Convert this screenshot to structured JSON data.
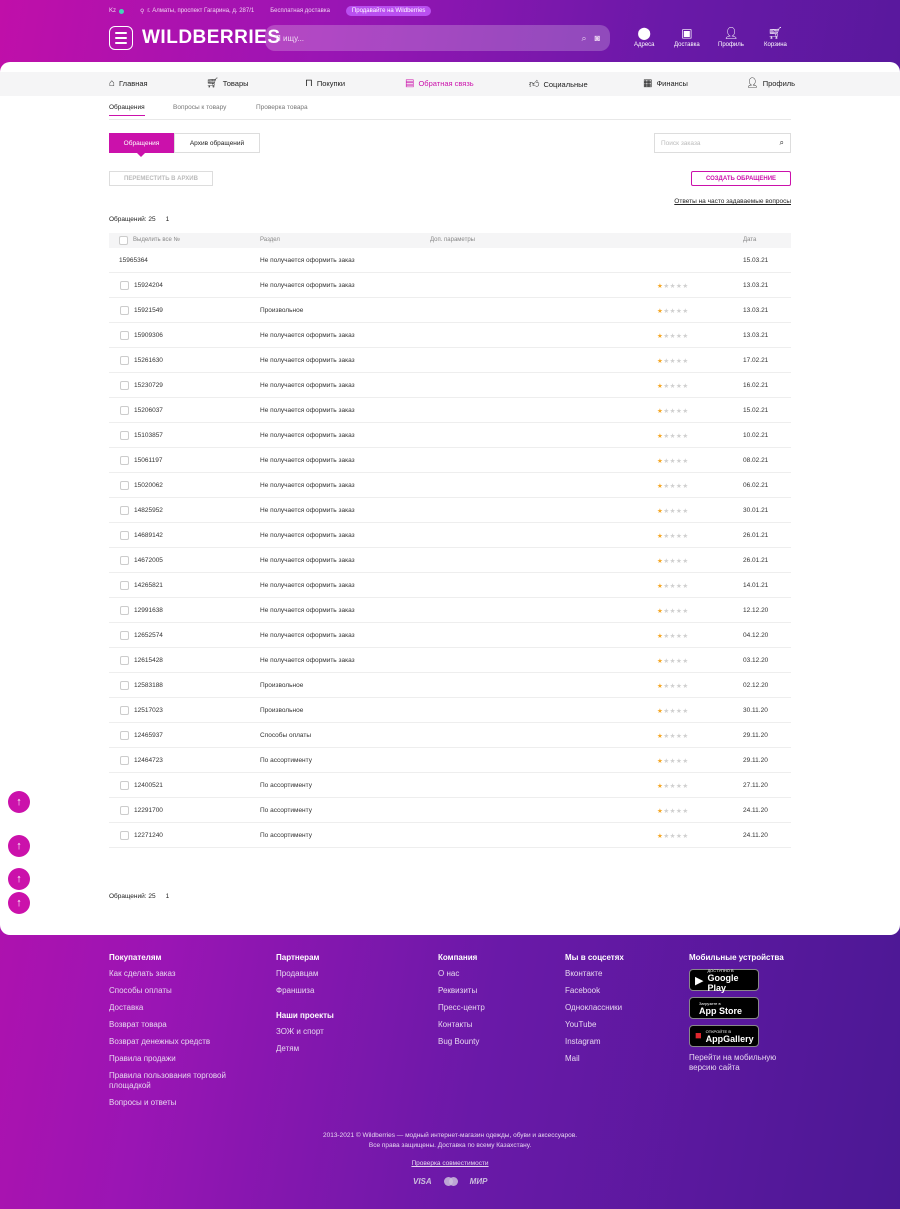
{
  "header": {
    "region": "Kz",
    "address": "г. Алматы, проспект Гагарина, д. 287/1",
    "free_delivery": "Бесплатная доставка",
    "sell_button": "Продавайте на Wildberries",
    "logo": "WILDBERRIES",
    "search_placeholder": "Я ищу...",
    "nav": {
      "addresses": "Адреса",
      "delivery": "Доставка",
      "profile": "Профиль",
      "cart": "Корзина"
    }
  },
  "category_nav": {
    "items": [
      "Главная",
      "Товары",
      "Покупки",
      "Обратная связь",
      "Социальные",
      "Финансы",
      "Профиль"
    ],
    "active_index": 3
  },
  "subtabs": [
    "Обращения",
    "Вопросы к товару",
    "Проверка товара"
  ],
  "toggle": {
    "active": "Обращения",
    "archive": "Архив обращений"
  },
  "order_search_placeholder": "Поиск заказа",
  "buttons": {
    "move_to_archive": "ПЕРЕМЕСТИТЬ В АРХИВ",
    "create_request": "СОЗДАТЬ ОБРАЩЕНИЕ"
  },
  "faq_link": "Ответы на часто задаваемые вопросы",
  "count": {
    "label": "Обращений: 25",
    "page": "1"
  },
  "table": {
    "headers": {
      "select_all": "Выделить все №",
      "section": "Раздел",
      "params": "Доп. параметры",
      "date": "Дата"
    },
    "rows": [
      {
        "id": "15965364",
        "section": "Не получается оформить заказ",
        "date": "15.03.21",
        "rating": 0,
        "checkbox": false
      },
      {
        "id": "15924204",
        "section": "Не получается оформить заказ",
        "date": "13.03.21",
        "rating": 1,
        "checkbox": true
      },
      {
        "id": "15921549",
        "section": "Произвольное",
        "date": "13.03.21",
        "rating": 1,
        "checkbox": true
      },
      {
        "id": "15909306",
        "section": "Не получается оформить заказ",
        "date": "13.03.21",
        "rating": 1,
        "checkbox": true
      },
      {
        "id": "15261630",
        "section": "Не получается оформить заказ",
        "date": "17.02.21",
        "rating": 1,
        "checkbox": true
      },
      {
        "id": "15230729",
        "section": "Не получается оформить заказ",
        "date": "16.02.21",
        "rating": 1,
        "checkbox": true
      },
      {
        "id": "15206037",
        "section": "Не получается оформить заказ",
        "date": "15.02.21",
        "rating": 1,
        "checkbox": true
      },
      {
        "id": "15103857",
        "section": "Не получается оформить заказ",
        "date": "10.02.21",
        "rating": 1,
        "checkbox": true
      },
      {
        "id": "15061197",
        "section": "Не получается оформить заказ",
        "date": "08.02.21",
        "rating": 1,
        "checkbox": true
      },
      {
        "id": "15020062",
        "section": "Не получается оформить заказ",
        "date": "06.02.21",
        "rating": 1,
        "checkbox": true
      },
      {
        "id": "14825952",
        "section": "Не получается оформить заказ",
        "date": "30.01.21",
        "rating": 1,
        "checkbox": true
      },
      {
        "id": "14689142",
        "section": "Не получается оформить заказ",
        "date": "26.01.21",
        "rating": 1,
        "checkbox": true
      },
      {
        "id": "14672005",
        "section": "Не получается оформить заказ",
        "date": "26.01.21",
        "rating": 1,
        "checkbox": true
      },
      {
        "id": "14265821",
        "section": "Не получается оформить заказ",
        "date": "14.01.21",
        "rating": 1,
        "checkbox": true
      },
      {
        "id": "12991638",
        "section": "Не получается оформить заказ",
        "date": "12.12.20",
        "rating": 1,
        "checkbox": true
      },
      {
        "id": "12652574",
        "section": "Не получается оформить заказ",
        "date": "04.12.20",
        "rating": 1,
        "checkbox": true
      },
      {
        "id": "12615428",
        "section": "Не получается оформить заказ",
        "date": "03.12.20",
        "rating": 1,
        "checkbox": true
      },
      {
        "id": "12583188",
        "section": "Произвольное",
        "date": "02.12.20",
        "rating": 1,
        "checkbox": true
      },
      {
        "id": "12517023",
        "section": "Произвольное",
        "date": "30.11.20",
        "rating": 1,
        "checkbox": true
      },
      {
        "id": "12465937",
        "section": "Способы оплаты",
        "date": "29.11.20",
        "rating": 1,
        "checkbox": true
      },
      {
        "id": "12464723",
        "section": "По ассортименту",
        "date": "29.11.20",
        "rating": 1,
        "checkbox": true
      },
      {
        "id": "12400521",
        "section": "По ассортименту",
        "date": "27.11.20",
        "rating": 1,
        "checkbox": true
      },
      {
        "id": "12291700",
        "section": "По ассортименту",
        "date": "24.11.20",
        "rating": 1,
        "checkbox": true
      },
      {
        "id": "12271240",
        "section": "По ассортименту",
        "date": "24.11.20",
        "rating": 1,
        "checkbox": true
      }
    ]
  },
  "footer": {
    "buyers": {
      "title": "Покупателям",
      "links": [
        "Как сделать заказ",
        "Способы оплаты",
        "Доставка",
        "Возврат товара",
        "Возврат денежных средств",
        "Правила продажи",
        "Правила пользования торговой площадкой",
        "Вопросы и ответы"
      ]
    },
    "partners": {
      "title": "Партнерам",
      "links": [
        "Продавцам",
        "Франшиза"
      ]
    },
    "projects": {
      "title": "Наши проекты",
      "links": [
        "ЗОЖ и спорт",
        "Детям"
      ]
    },
    "company": {
      "title": "Компания",
      "links": [
        "О нас",
        "Реквизиты",
        "Пресс-центр",
        "Контакты",
        "Bug Bounty"
      ]
    },
    "social": {
      "title": "Мы в соцсетях",
      "links": [
        "Вконтакте",
        "Facebook",
        "Одноклассники",
        "YouTube",
        "Instagram",
        "Mail"
      ]
    },
    "mobile": {
      "title": "Мобильные устройства",
      "stores": [
        {
          "small": "ДОСТУПНО В",
          "name": "Google Play"
        },
        {
          "small": "Загрузите в",
          "name": "App Store"
        },
        {
          "small": "ОТКРОЙТЕ В",
          "name": "AppGallery"
        }
      ],
      "mobile_link": "Перейти на мобильную версию сайта"
    },
    "copyright_line1": "2013-2021 © Wildberries — модный интернет-магазин одежды, обуви и аксессуаров.",
    "copyright_line2": "Все права защищены. Доставка по всему Казахстану.",
    "compat": "Проверка совместимости",
    "payments": [
      "VISA",
      "МИР"
    ]
  },
  "colors": {
    "brand": "#cb11ab",
    "star": "#f5a623"
  },
  "icons": {
    "scroll_up": "arrow-up-icon",
    "search": "search-icon",
    "camera": "camera-icon"
  }
}
